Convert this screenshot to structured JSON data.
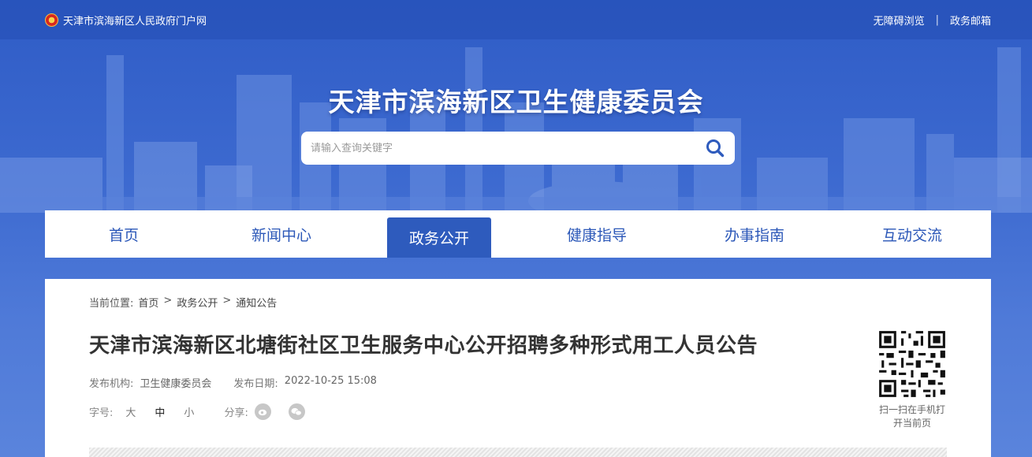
{
  "topbar": {
    "portal_name": "天津市滨海新区人民政府门户网",
    "accessibility": "无障碍浏览",
    "separator": "|",
    "gov_mail": "政务邮箱"
  },
  "header": {
    "site_title": "天津市滨海新区卫生健康委员会"
  },
  "search": {
    "placeholder": "请输入查询关键字"
  },
  "nav": {
    "items": [
      {
        "label": "首页"
      },
      {
        "label": "新闻中心"
      },
      {
        "label": "政务公开"
      },
      {
        "label": "健康指导"
      },
      {
        "label": "办事指南"
      },
      {
        "label": "互动交流"
      }
    ],
    "active_index": 2
  },
  "breadcrumb": {
    "prefix": "当前位置:",
    "items": [
      "首页",
      "政务公开",
      "通知公告"
    ],
    "separator": ">"
  },
  "article": {
    "title": "天津市滨海新区北塘街社区卫生服务中心公开招聘多种形式用工人员公告",
    "publisher_label": "发布机构:",
    "publisher": "卫生健康委员会",
    "date_label": "发布日期:",
    "date": "2022-10-25 15:08",
    "font_size_label": "字号:",
    "font_sizes": [
      "大",
      "中",
      "小"
    ],
    "current_font_size": "中",
    "share_label": "分享:"
  },
  "qr": {
    "caption": "扫一扫在手机打开当前页"
  },
  "colors": {
    "primary": "#2e5bbd",
    "nav_text": "#2b57b8",
    "hero": "#3d6ad0"
  }
}
